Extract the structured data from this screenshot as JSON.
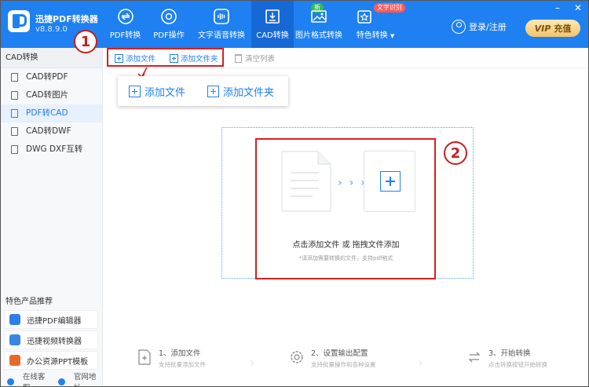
{
  "app": {
    "name": "迅捷PDF转换器",
    "version": "v8.8.9.0"
  },
  "nav": {
    "items": [
      {
        "label": "PDF转换",
        "icon": "convert-icon"
      },
      {
        "label": "PDF操作",
        "icon": "gear-icon"
      },
      {
        "label": "文字语音转换",
        "icon": "waveform-icon"
      },
      {
        "label": "CAD转换",
        "icon": "cad-icon",
        "active": true
      },
      {
        "label": "图片格式转换",
        "icon": "image-icon",
        "badge": "新"
      },
      {
        "label": "特色转换",
        "icon": "star-icon",
        "badge": "文字识别"
      }
    ],
    "dropdown_arrow": "▼"
  },
  "header": {
    "login_label": "登录/注册",
    "vip_label": "VIP",
    "vip_action": "充值"
  },
  "window_controls": [
    "–",
    "✕"
  ],
  "sidebar": {
    "title": "CAD转换",
    "items": [
      {
        "label": "CAD转PDF"
      },
      {
        "label": "CAD转图片"
      },
      {
        "label": "PDF转CAD",
        "active": true
      },
      {
        "label": "CAD转DWF"
      },
      {
        "label": "DWG DXF互转"
      }
    ],
    "featured_title": "特色产品推荐",
    "featured": [
      {
        "label": "迅捷PDF编辑器",
        "color": "#2d7ee8"
      },
      {
        "label": "迅捷视频转换器",
        "color": "#3a86e0"
      },
      {
        "label": "办公资源PPT模板",
        "color": "#e66b2a"
      }
    ],
    "support": {
      "online": "在线客服",
      "website": "官网地址"
    }
  },
  "toolbar": {
    "add_file": "添加文件",
    "add_folder": "添加文件夹",
    "clear_list": "清空列表"
  },
  "annotations": {
    "one": "1",
    "two": "2"
  },
  "zoom": {
    "add_file": "添加文件",
    "add_folder": "添加文件夹"
  },
  "drop": {
    "main_text": "点击添加文件 或 拖拽文件添加",
    "hint": "*请添加需要转换的文件，支持pdf格式",
    "arrows": "› › ›"
  },
  "steps": [
    {
      "title": "1、添加文件",
      "sub": "支持批量添加文件"
    },
    {
      "title": "2、设置输出配置",
      "sub": "支持批量操作和各种设置"
    },
    {
      "title": "3、开始转换",
      "sub": "点击转换按钮开始转换"
    }
  ],
  "colors": {
    "brand": "#1f80f1",
    "annotation_red": "#d62020"
  }
}
